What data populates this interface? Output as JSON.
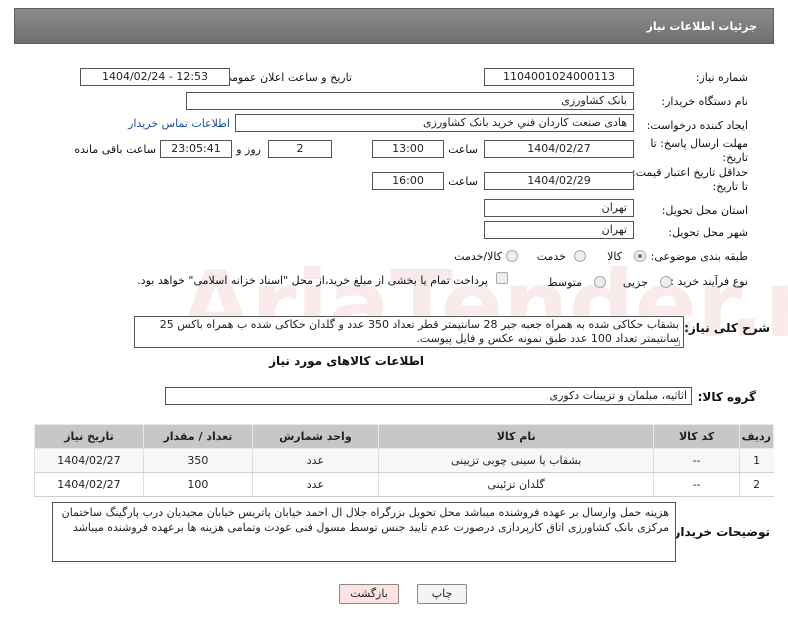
{
  "page_title": "جزئیات اطلاعات نیاز",
  "fields": {
    "need_number_label": "شماره نیاز:",
    "need_number": "1104001024000113",
    "announce_label": "تاریخ و ساعت اعلان عمومی:",
    "announce_value": "1404/02/24 - 12:53",
    "buyer_org_label": "نام دستگاه خریدار:",
    "buyer_org": "بانک کشاورزی",
    "creator_label": "ایجاد کننده درخواست:",
    "creator": "هادی صنعت کاردان فني خريد بانک کشاورزی",
    "contact_link": "اطلاعات تماس خریدار",
    "deadline_label": "مهلت ارسال پاسخ: تا تاریخ:",
    "deadline_date": "1404/02/27",
    "time_word": "ساعت",
    "deadline_time": "13:00",
    "days_value": "2",
    "days_and": "روز و",
    "remaining_time": "23:05:41",
    "remaining_label": "ساعت باقی مانده",
    "validity_label": "حداقل تاریخ اعتبار قیمت: تا تاریخ:",
    "validity_date": "1404/02/29",
    "validity_time": "16:00",
    "province_label": "استان محل تحویل:",
    "province": "تهران",
    "city_label": "شهر محل تحویل:",
    "city": "تهران",
    "category_label": "طبقه بندی موضوعی:",
    "category_options": [
      "کالا",
      "خدمت",
      "کالا/خدمت"
    ],
    "process_label": "نوع فرآیند خرید :",
    "process_options": [
      "جزیی",
      "متوسط"
    ],
    "payment_note": "پرداخت تمام یا بخشی از مبلغ خرید،از محل \"اسناد خزانه اسلامی\" خواهد بود."
  },
  "watermark": "AriaTender.neT",
  "description": {
    "label": "شرح کلی نیاز:",
    "text": "بشقاب حکاکی شده به همراه جعبه جیر 28 سانتیمتر قطر تعداد 350 عدد و گلدان حکاکی شده ب همراه باکس 25 سانتیمتر تعداد 100 عدد طبق نمونه عکس و فایل پیوست."
  },
  "items_section_title": "اطلاعات کالاهای مورد نیاز",
  "group": {
    "label": "گروه کالا:",
    "value": "اثاثیه، مبلمان و تزیینات دکوری"
  },
  "table": {
    "headers": [
      "ردیف",
      "کد کالا",
      "نام کالا",
      "واحد شمارش",
      "تعداد / مقدار",
      "تاریخ نیاز"
    ],
    "rows": [
      [
        "1",
        "--",
        "بشقاب یا سینی چوبی تزیینی",
        "عدد",
        "350",
        "1404/02/27"
      ],
      [
        "2",
        "--",
        "گلدان تزئینی",
        "عدد",
        "100",
        "1404/02/27"
      ]
    ]
  },
  "buyer_notes": {
    "label": "توضیحات خریدار:",
    "text": "هزینه حمل وارسال بر عهده فروشنده میباشد محل تحویل بزرگراه جلال ال احمد خیابان پاتریس خیابان مجیدیان درب پارگینگ ساختمان مرکزی بانک کشاورزی اتاق کارپردازی درصورت عدم تایید جنس توسط مسول فنی عودت وتمامی هزینه ها برعهده فروشنده میباشد"
  },
  "buttons": {
    "print": "چاپ",
    "back": "بازگشت"
  }
}
